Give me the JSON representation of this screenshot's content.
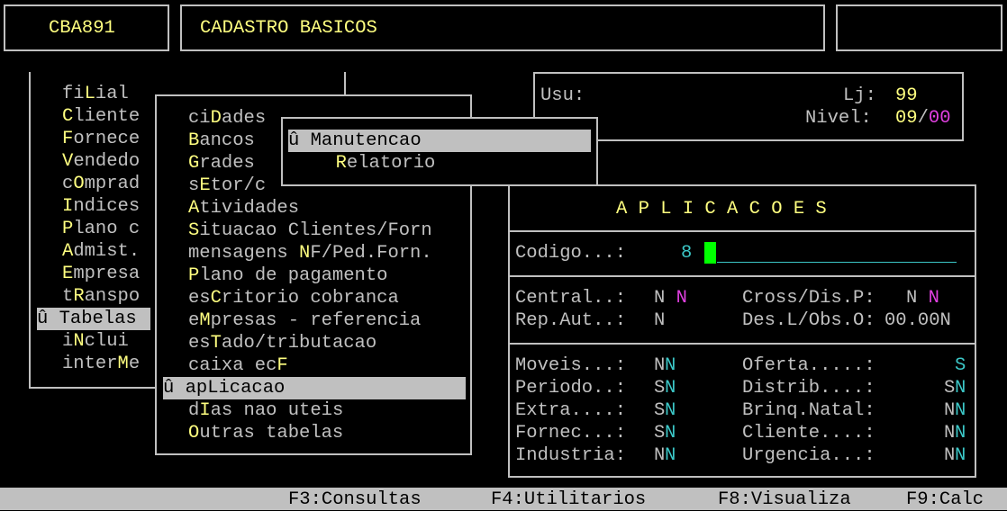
{
  "header": {
    "program": "CBA891",
    "title": "CADASTRO BASICOS",
    "right": ""
  },
  "user_panel": {
    "usu_label": "Usu:",
    "usu_value": "",
    "lj_label": "Lj:",
    "lj_value": "99",
    "nivel_label": "Nivel:",
    "nivel_value": "09",
    "nivel_sep": "/",
    "nivel_value2": "00"
  },
  "menu1": {
    "items": [
      {
        "pre": "fi",
        "hot": "L",
        "post": "ial"
      },
      {
        "pre": "",
        "hot": "C",
        "post": "liente"
      },
      {
        "pre": "",
        "hot": "F",
        "post": "ornece"
      },
      {
        "pre": "",
        "hot": "V",
        "post": "endedo"
      },
      {
        "pre": "c",
        "hot": "O",
        "post": "mprad"
      },
      {
        "pre": "",
        "hot": "I",
        "post": "ndices"
      },
      {
        "pre": "",
        "hot": "P",
        "post": "lano c"
      },
      {
        "pre": "",
        "hot": "A",
        "post": "dmist."
      },
      {
        "pre": "",
        "hot": "E",
        "post": "mpresa"
      },
      {
        "pre": "t",
        "hot": "R",
        "post": "anspo"
      },
      {
        "pre": "û Tabelas",
        "hot": "",
        "post": ""
      },
      {
        "pre": "i",
        "hot": "N",
        "post": "clui"
      },
      {
        "pre": "inter",
        "hot": "M",
        "post": "e"
      }
    ]
  },
  "menu2": {
    "items": [
      {
        "pre": "ci",
        "hot": "D",
        "post": "ades"
      },
      {
        "pre": "",
        "hot": "B",
        "post": "ancos"
      },
      {
        "pre": "",
        "hot": "G",
        "post": "rades"
      },
      {
        "pre": "s",
        "hot": "E",
        "post": "tor/c"
      },
      {
        "pre": "",
        "hot": "A",
        "post": "tividades"
      },
      {
        "pre": "",
        "hot": "S",
        "post": "ituacao Clientes/Forn"
      },
      {
        "pre": "mensagens ",
        "hot": "N",
        "post": "F/Ped.Forn."
      },
      {
        "pre": "",
        "hot": "P",
        "post": "lano de pagamento"
      },
      {
        "pre": "es",
        "hot": "C",
        "post": "ritorio cobranca"
      },
      {
        "pre": "e",
        "hot": "M",
        "post": "presas - referencia"
      },
      {
        "pre": "es",
        "hot": "T",
        "post": "ado/tributacao"
      },
      {
        "pre": "caixa ec",
        "hot": "F",
        "post": ""
      },
      {
        "pre": "û apLicacao",
        "hot": "",
        "post": ""
      },
      {
        "pre": "d",
        "hot": "I",
        "post": "as nao uteis"
      },
      {
        "pre": "",
        "hot": "O",
        "post": "utras tabelas"
      }
    ]
  },
  "menu3": {
    "items": [
      {
        "pre": "û Manutencao",
        "hot": "",
        "post": ""
      },
      {
        "pre": "  ",
        "hot": "R",
        "post": "elatorio"
      }
    ]
  },
  "app": {
    "title": "A P L I C A C O E S",
    "codigo_label": "Codigo...:",
    "codigo_value": "8",
    "central_label": "Central..:",
    "central_v1": "N",
    "central_v2": "N",
    "cross_label": "Cross/Dis.P:",
    "cross_v1": "N",
    "cross_v2": "N",
    "rep_label": "Rep.Aut..:",
    "rep_v1": "N",
    "des_label": "Des.L/Obs.O:",
    "des_v1": "00.00",
    "des_v2": "N",
    "rows": [
      {
        "l": "Moveis...:",
        "a": "N",
        "b": "N",
        "r": "Oferta.....:",
        "c": " ",
        "d": "S"
      },
      {
        "l": "Periodo..:",
        "a": "S",
        "b": "N",
        "r": "Distrib....:",
        "c": "S",
        "d": "N"
      },
      {
        "l": "Extra....:",
        "a": "S",
        "b": "N",
        "r": "Brinq.Natal:",
        "c": "N",
        "d": "N"
      },
      {
        "l": "Fornec...:",
        "a": "S",
        "b": "N",
        "r": "Cliente....:",
        "c": "N",
        "d": "N"
      },
      {
        "l": "Industria:",
        "a": "N",
        "b": "N",
        "r": "Urgencia...:",
        "c": "N",
        "d": "N"
      }
    ]
  },
  "footer": {
    "f3": "F3:Consultas",
    "f4": "F4:Utilitarios",
    "f8": "F8:Visualiza",
    "f9": "F9:Calc"
  },
  "colors": {
    "hotkey": "#ffff80",
    "text": "#c0c0c0",
    "cyan": "#3cc8c8",
    "magenta": "#e040e0",
    "cursor": "#00ff00",
    "selection": "#c0c0c0"
  }
}
